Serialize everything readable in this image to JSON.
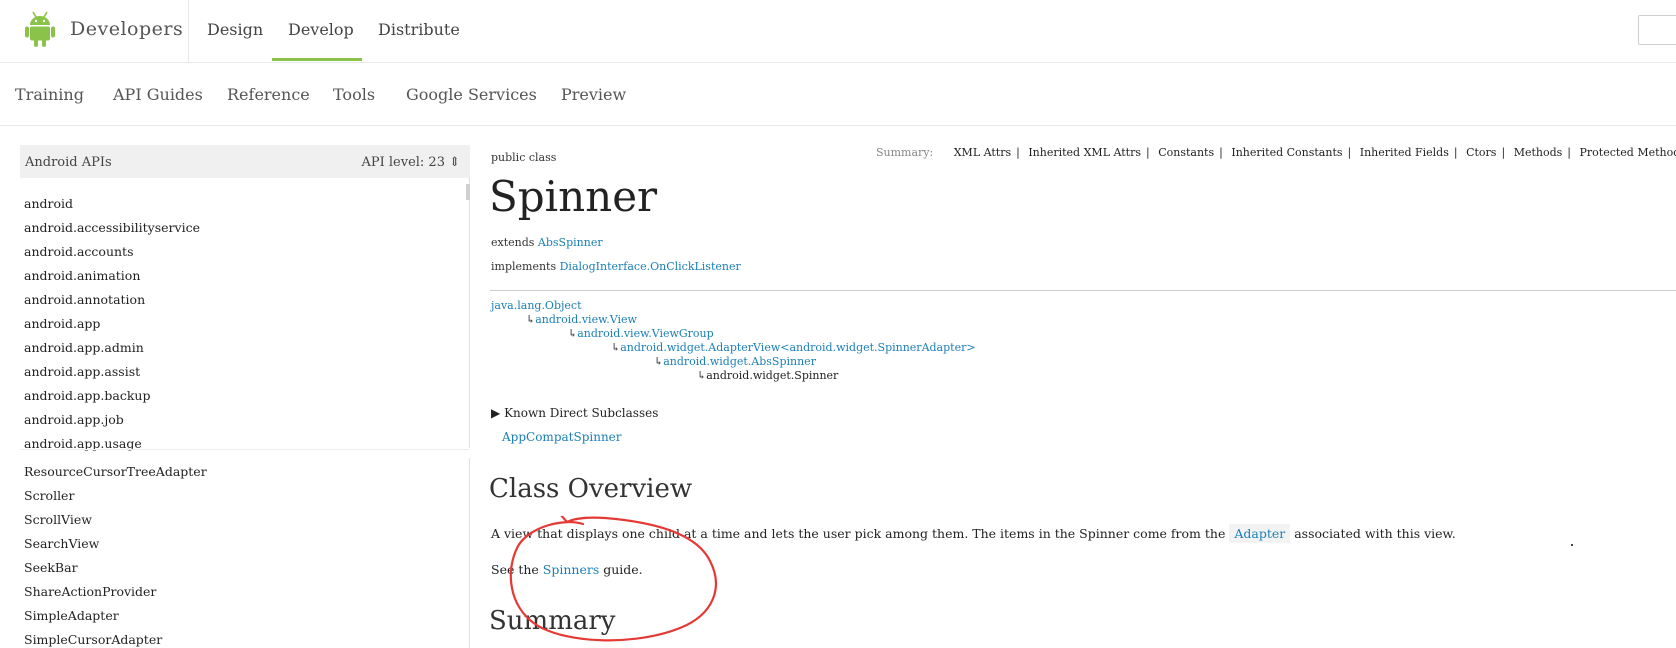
{
  "header": {
    "brand": "Developers",
    "tabs": [
      {
        "label": "Design",
        "active": false
      },
      {
        "label": "Develop",
        "active": true
      },
      {
        "label": "Distribute",
        "active": false
      }
    ],
    "logo_icon": "android-robot-icon",
    "accent": "#8bc34a"
  },
  "subnav": {
    "items": [
      "Training",
      "API Guides",
      "Reference",
      "Tools",
      "Google Services",
      "Preview"
    ]
  },
  "sidebar": {
    "title": "Android APIs",
    "api_level": "API level: 23 ⇕",
    "packages": [
      "android",
      "android.accessibilityservice",
      "android.accounts",
      "android.animation",
      "android.annotation",
      "android.app",
      "android.app.admin",
      "android.app.assist",
      "android.app.backup",
      "android.app.job",
      "android.app.usage"
    ],
    "classes": [
      "ResourceCursorTreeAdapter",
      "Scroller",
      "ScrollView",
      "SearchView",
      "SeekBar",
      "ShareActionProvider",
      "SimpleAdapter",
      "SimpleCursorAdapter"
    ]
  },
  "content": {
    "public_class": "public class",
    "summary_label": "Summary:",
    "summary_links": [
      "XML Attrs",
      "Inherited XML Attrs",
      "Constants",
      "Inherited Constants",
      "Inherited Fields",
      "Ctors",
      "Methods",
      "Protected Methods"
    ],
    "class_name": "Spinner",
    "extends_label": "extends",
    "extends_value": "AbsSpinner",
    "implements_label": "implements",
    "implements_value": "DialogInterface.OnClickListener",
    "hierarchy": [
      {
        "text": "java.lang.Object",
        "link": true
      },
      {
        "text": "android.view.View",
        "link": true
      },
      {
        "text": "android.view.ViewGroup",
        "link": true
      },
      {
        "text": "android.widget.AdapterView<android.widget.SpinnerAdapter>",
        "link": true
      },
      {
        "text": "android.widget.AbsSpinner",
        "link": true
      },
      {
        "text": "android.widget.Spinner",
        "link": false
      }
    ],
    "known_subclasses_label": "Known Direct Subclasses",
    "known_subclasses": [
      "AppCompatSpinner"
    ],
    "overview_title": "Class Overview",
    "overview_before": "A view that displays one child at a time and lets the user pick among them. The items in the Spinner come from the",
    "overview_link": "Adapter",
    "overview_after": "associated with this view.",
    "see_before": "See the",
    "see_link": "Spinners",
    "see_after": "guide.",
    "summary_title": "Summary"
  }
}
